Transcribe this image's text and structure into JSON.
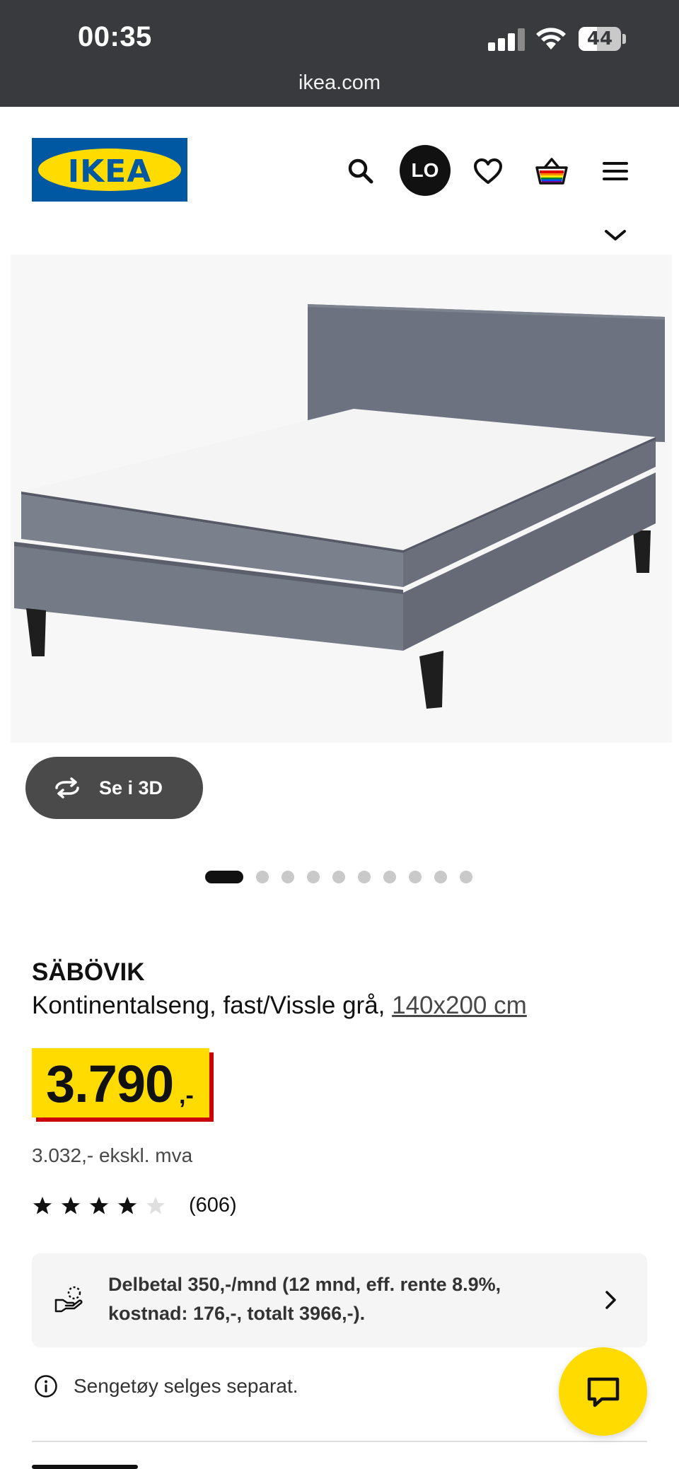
{
  "status_bar": {
    "time": "00:35",
    "battery": "44",
    "battery_level": 0.44
  },
  "browser": {
    "url": "ikea.com"
  },
  "header": {
    "logo": "IKEA",
    "avatar_initials": "LO",
    "icons": [
      "search-icon",
      "heart-icon",
      "basket-icon",
      "menu-icon"
    ]
  },
  "gallery": {
    "view_3d_label": "Se i 3D",
    "image_count": 10,
    "active_index": 0
  },
  "product": {
    "name": "SÄBÖVIK",
    "description": "Kontinentalseng, fast/Vissle grå, ",
    "size": "140x200 cm",
    "price": "3.790",
    "price_suffix": ",-",
    "price_ex_vat": "3.032,- ekskl. mva",
    "rating": 4,
    "rating_max": 5,
    "review_count": "(606)"
  },
  "payment": {
    "text": "Delbetal 350,-/mnd (12 mnd, eff. rente 8.9%, kostnad: 176,-, totalt 3966,-)."
  },
  "notice": {
    "text": "Sengetøy selges separat."
  },
  "colors": {
    "ikea_blue": "#0058a3",
    "ikea_yellow": "#ffdb00",
    "price_red": "#cc0008",
    "statusbar": "#383a3d"
  }
}
